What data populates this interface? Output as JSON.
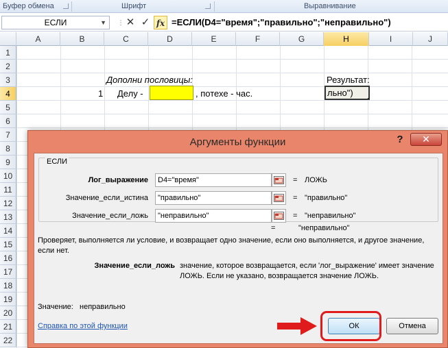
{
  "ribbon": {
    "groups": [
      {
        "label": "Буфер обмена"
      },
      {
        "label": "Шрифт"
      },
      {
        "label": "Выравнивание"
      }
    ]
  },
  "formula_bar": {
    "name_box": "ЕСЛИ",
    "cancel_icon": "✕",
    "enter_icon": "✓",
    "fx_label": "fx",
    "formula": "=ЕСЛИ(D4=\"время\";\"правильно\";\"неправильно\")"
  },
  "sheet": {
    "columns": [
      "A",
      "B",
      "C",
      "D",
      "E",
      "F",
      "G",
      "H",
      "I",
      "J"
    ],
    "active_column": "H",
    "rows": [
      "1",
      "2",
      "3",
      "4",
      "5",
      "6",
      "7",
      "8",
      "9",
      "10",
      "11",
      "12",
      "13",
      "14",
      "15",
      "16",
      "17",
      "18",
      "19",
      "20",
      "21",
      "22"
    ],
    "active_row": "4",
    "c3": "Дополни пословицы:",
    "h3": "Результат:",
    "b4": "1",
    "c4": "Делу -",
    "e4": ", потехе - час.",
    "h4": "льно\")",
    "d4_fill": "#ffff00"
  },
  "dialog": {
    "title": "Аргументы функции",
    "help": "?",
    "close": "✕",
    "group_name": "ЕСЛИ",
    "args": [
      {
        "label": "Лог_выражение",
        "value": "D4=\"время\"",
        "result": "ЛОЖЬ",
        "bold": true
      },
      {
        "label": "Значение_если_истина",
        "value": "\"правильно\"",
        "result": "\"правильно\"",
        "bold": false
      },
      {
        "label": "Значение_если_ложь",
        "value": "\"неправильно\"",
        "result": "\"неправильно\"",
        "bold": false
      }
    ],
    "eq": "=",
    "overall_result": "\"неправильно\"",
    "description": "Проверяет, выполняется ли условие, и возвращает одно значение, если оно выполняется, и другое значение, если нет.",
    "arg_help_name": "Значение_если_ложь",
    "arg_help_text": "значение, которое возвращается, если 'лог_выражение' имеет значение ЛОЖЬ. Если не указано, возвращается значение ЛОЖЬ.",
    "value_label": "Значение:",
    "value": "неправильно",
    "help_link": "Справка по этой функции",
    "ok_label": "ОК",
    "cancel_label": "Отмена"
  },
  "colors": {
    "dialog_frame": "#e8856a",
    "highlight_ring": "#e01b1b",
    "active_header": "#f6cf62"
  }
}
